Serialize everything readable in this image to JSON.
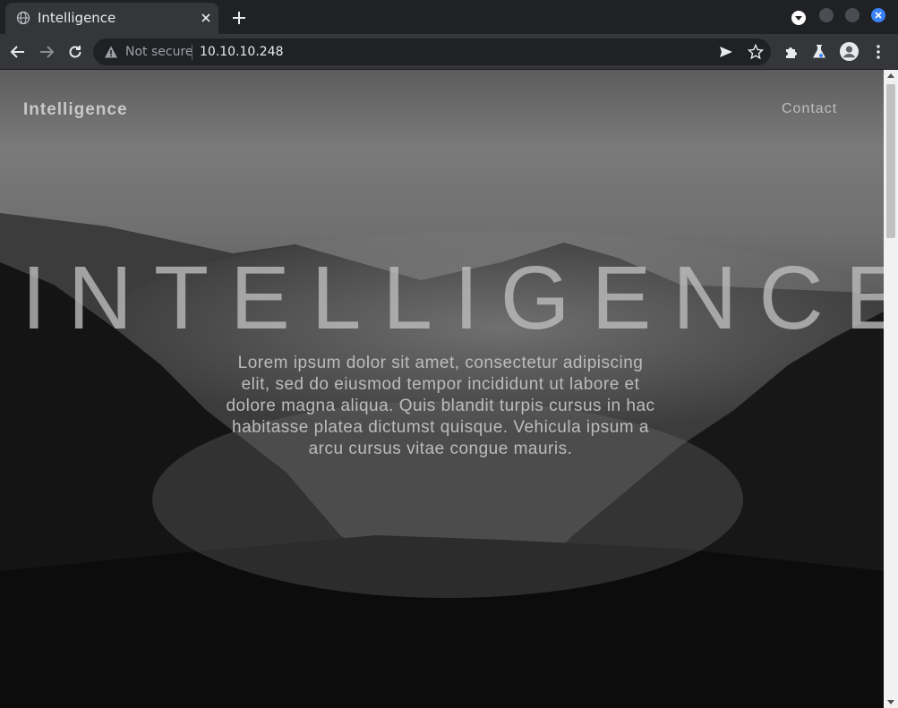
{
  "browser": {
    "tab": {
      "title": "Intelligence",
      "icon": "globe-icon"
    },
    "address": {
      "security_label": "Not secure",
      "url": "10.10.10.248"
    },
    "accent_color": "#3a82f7"
  },
  "page": {
    "brand": "Intelligence",
    "nav": {
      "contact": "Contact"
    },
    "hero": {
      "title": "INTELLIGENCE",
      "text": "Lorem ipsum dolor sit amet, consectetur adipiscing elit, sed do eiusmod tempor incididunt ut labore et dolore magna aliqua. Quis blandit turpis cursus in hac habitasse platea dictumst quisque. Vehicula ipsum a arcu cursus vitae congue mauris."
    }
  }
}
